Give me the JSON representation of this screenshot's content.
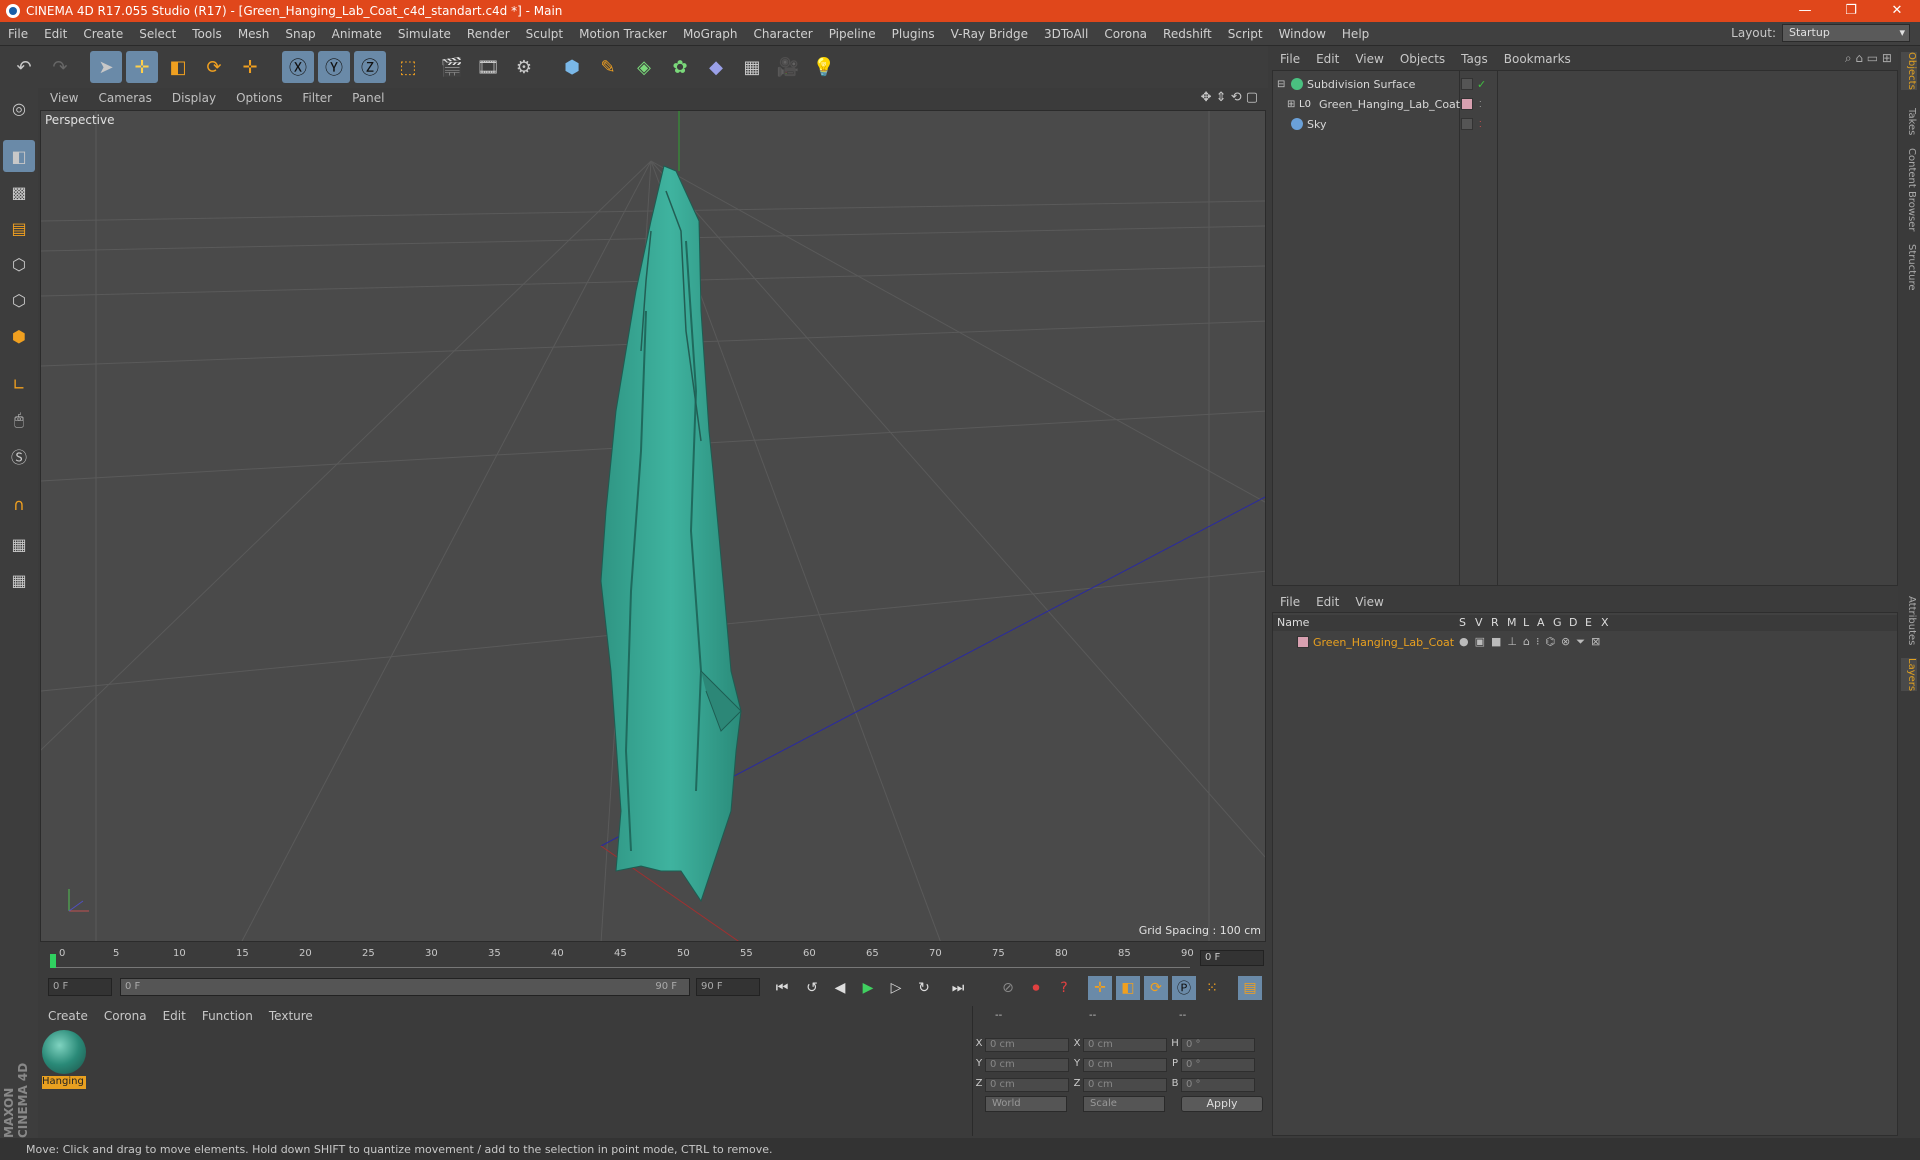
{
  "titlebar": {
    "title": "CINEMA 4D R17.055 Studio (R17) - [Green_Hanging_Lab_Coat_c4d_standart.c4d *] - Main",
    "min": "—",
    "max": "❐",
    "close": "✕"
  },
  "menubar": {
    "items": [
      "File",
      "Edit",
      "Create",
      "Select",
      "Tools",
      "Mesh",
      "Snap",
      "Animate",
      "Simulate",
      "Render",
      "Sculpt",
      "Motion Tracker",
      "MoGraph",
      "Character",
      "Pipeline",
      "Plugins",
      "V-Ray Bridge",
      "3DToAll",
      "Corona",
      "Redshift",
      "Script",
      "Window",
      "Help"
    ],
    "layout_label": "Layout:",
    "layout_value": "Startup"
  },
  "viewport": {
    "menu": [
      "View",
      "Cameras",
      "Display",
      "Options",
      "Filter",
      "Panel"
    ],
    "camera_label": "Perspective",
    "grid_spacing": "Grid Spacing : 100 cm"
  },
  "timeline": {
    "ticks": [
      "0",
      "5",
      "10",
      "15",
      "20",
      "25",
      "30",
      "35",
      "40",
      "45",
      "50",
      "55",
      "60",
      "65",
      "70",
      "75",
      "80",
      "85",
      "90"
    ],
    "current_frame": "0 F",
    "start_field": "0 F",
    "range_start": "0 F",
    "range_end": "90 F",
    "end_field": "90 F"
  },
  "materials": {
    "menu": [
      "Create",
      "Corona",
      "Edit",
      "Function",
      "Texture"
    ],
    "items": [
      {
        "name": "Hanging"
      }
    ]
  },
  "coords": {
    "headers": [
      "--",
      "--",
      "--"
    ],
    "rows": [
      {
        "a": "X",
        "av": "0 cm",
        "b": "X",
        "bv": "0 cm",
        "c": "H",
        "cv": "0 °"
      },
      {
        "a": "Y",
        "av": "0 cm",
        "b": "Y",
        "bv": "0 cm",
        "c": "P",
        "cv": "0 °"
      },
      {
        "a": "Z",
        "av": "0 cm",
        "b": "Z",
        "bv": "0 cm",
        "c": "B",
        "cv": "0 °"
      }
    ],
    "space": "World",
    "mode": "Scale",
    "apply": "Apply"
  },
  "objects": {
    "menu": [
      "File",
      "Edit",
      "View",
      "Objects",
      "Tags",
      "Bookmarks"
    ],
    "items": [
      {
        "name": "Subdivision Surface",
        "icon": "subdivision-icon"
      },
      {
        "name": "Green_Hanging_Lab_Coat",
        "icon": "null-icon"
      },
      {
        "name": "Sky",
        "icon": "sky-icon"
      }
    ]
  },
  "layers": {
    "menu": [
      "File",
      "Edit",
      "View"
    ],
    "columns": [
      "Name",
      "S",
      "V",
      "R",
      "M",
      "L",
      "A",
      "G",
      "D",
      "E",
      "X"
    ],
    "items": [
      {
        "name": "Green_Hanging_Lab_Coat"
      }
    ]
  },
  "sidetabs": [
    "Objects",
    "Takes",
    "Content Browser",
    "Structure",
    "Attributes",
    "Layers"
  ],
  "status": "Move: Click and drag to move elements. Hold down SHIFT to quantize movement / add to the selection in point mode, CTRL to remove.",
  "branding": "MAXON CINEMA 4D",
  "colors": {
    "titlebar": "#e0471b",
    "accent": "#e8a020",
    "coat": "#35a896"
  }
}
